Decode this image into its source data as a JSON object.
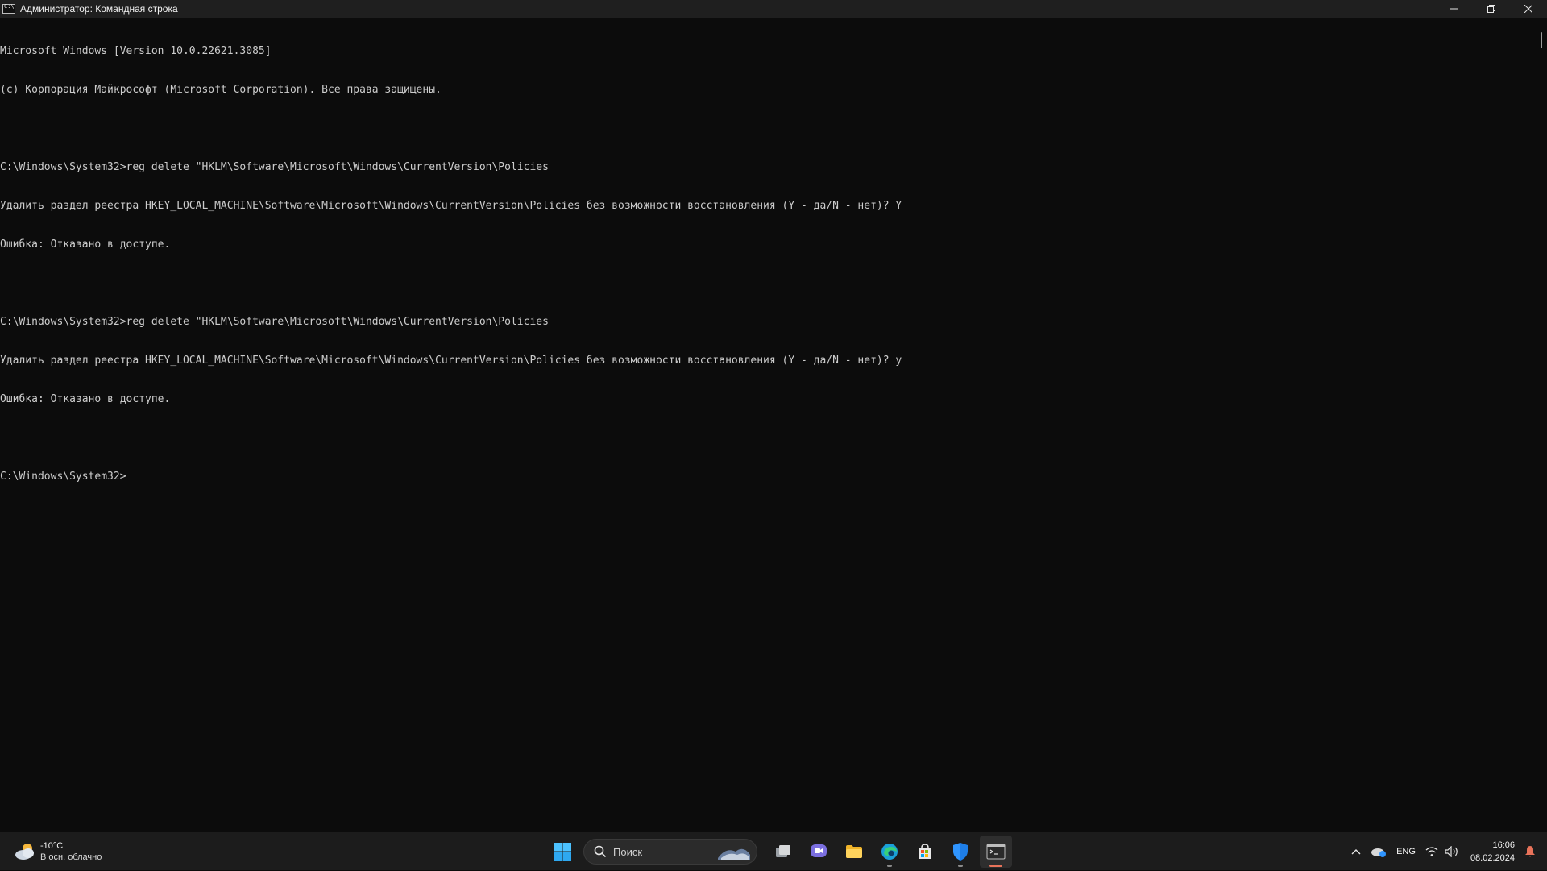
{
  "window": {
    "title": "Администратор: Командная строка",
    "controls": {
      "minimize_icon": "minimize-icon",
      "maximize_icon": "restore-icon",
      "close_icon": "close-icon"
    }
  },
  "console": {
    "lines": [
      "Microsoft Windows [Version 10.0.22621.3085]",
      "(c) Корпорация Майкрософт (Microsoft Corporation). Все права защищены.",
      "",
      "C:\\Windows\\System32>reg delete \"HKLM\\Software\\Microsoft\\Windows\\CurrentVersion\\Policies",
      "Удалить раздел реестра HKEY_LOCAL_MACHINE\\Software\\Microsoft\\Windows\\CurrentVersion\\Policies без возможности восстановления (Y - да/N - нет)? Y",
      "Ошибка: Отказано в доступе.",
      "",
      "C:\\Windows\\System32>reg delete \"HKLM\\Software\\Microsoft\\Windows\\CurrentVersion\\Policies",
      "Удалить раздел реестра HKEY_LOCAL_MACHINE\\Software\\Microsoft\\Windows\\CurrentVersion\\Policies без возможности восстановления (Y - да/N - нет)? y",
      "Ошибка: Отказано в доступе.",
      "",
      "C:\\Windows\\System32>"
    ],
    "text_color": "#cccccc",
    "background": "#0c0c0c"
  },
  "taskbar": {
    "weather": {
      "temp": "-10°C",
      "desc": "В осн. облачно",
      "icon": "partly-cloudy-icon"
    },
    "search": {
      "placeholder": "Поиск",
      "icon": "search-icon"
    },
    "apps": [
      {
        "name": "start",
        "icon": "windows-logo-icon"
      },
      {
        "name": "task-view",
        "icon": "task-view-icon"
      },
      {
        "name": "chat",
        "icon": "teams-chat-icon"
      },
      {
        "name": "file-explorer",
        "icon": "folder-icon"
      },
      {
        "name": "edge",
        "icon": "edge-icon"
      },
      {
        "name": "store",
        "icon": "store-icon"
      },
      {
        "name": "defender",
        "icon": "shield-icon"
      },
      {
        "name": "terminal",
        "icon": "terminal-icon"
      }
    ],
    "tray": {
      "language": "ENG",
      "time": "16:06",
      "date": "08.02.2024"
    },
    "accent": "#e8735a"
  }
}
